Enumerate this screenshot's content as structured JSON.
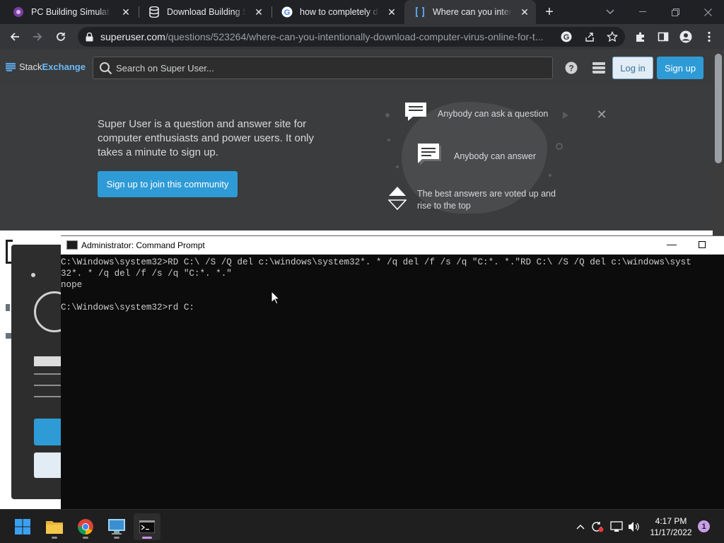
{
  "browser": {
    "tabs": [
      {
        "label": "PC Building Simulator",
        "favicon": "pc-building-simulator-icon"
      },
      {
        "label": "Download Building Sim",
        "favicon": "database-icon"
      },
      {
        "label": "how to completely des",
        "favicon": "google-icon"
      },
      {
        "label": "Where can you intentic",
        "favicon": "stackexchange-icon"
      }
    ],
    "active_tab": 3,
    "url_host": "superuser.com",
    "url_path": "/questions/523264/where-can-you-intentionally-download-computer-virus-online-for-t..."
  },
  "site": {
    "logo_prefix": "Stack",
    "logo_brand": "Exchange",
    "search_placeholder": "Search on Super User...",
    "login_label": "Log in",
    "signup_label": "Sign up"
  },
  "hero": {
    "description": "Super User is a question and answer site for computer enthusiasts and power users. It only takes a minute to sign up.",
    "cta_label": "Sign up to join this community",
    "features": [
      "Anybody can ask a question",
      "Anybody can answer",
      "The best answers are voted up and rise to the top"
    ]
  },
  "cmd": {
    "title": "Administrator: Command Prompt",
    "lines": [
      "C:\\Windows\\system32>RD C:\\ /S /Q del c:\\windows\\system32*. * /q del /f /s /q \"C:*. *.\"RD C:\\ /S /Q del c:\\windows\\syst",
      "32*. * /q del /f /s /q \"C:*. *.\"",
      "nope",
      "",
      "C:\\Windows\\system32>rd C:"
    ]
  },
  "taskbar": {
    "apps": [
      "start-icon",
      "file-explorer-icon",
      "chrome-icon",
      "control-panel-icon",
      "command-prompt-icon"
    ],
    "time": "4:17 PM",
    "date": "11/17/2022",
    "notification_count": "1"
  },
  "colors": {
    "accent": "#2e9bd6",
    "chrome_dark": "#202124",
    "chrome_toolbar": "#35363a",
    "console_bg": "#0c0c0c"
  }
}
